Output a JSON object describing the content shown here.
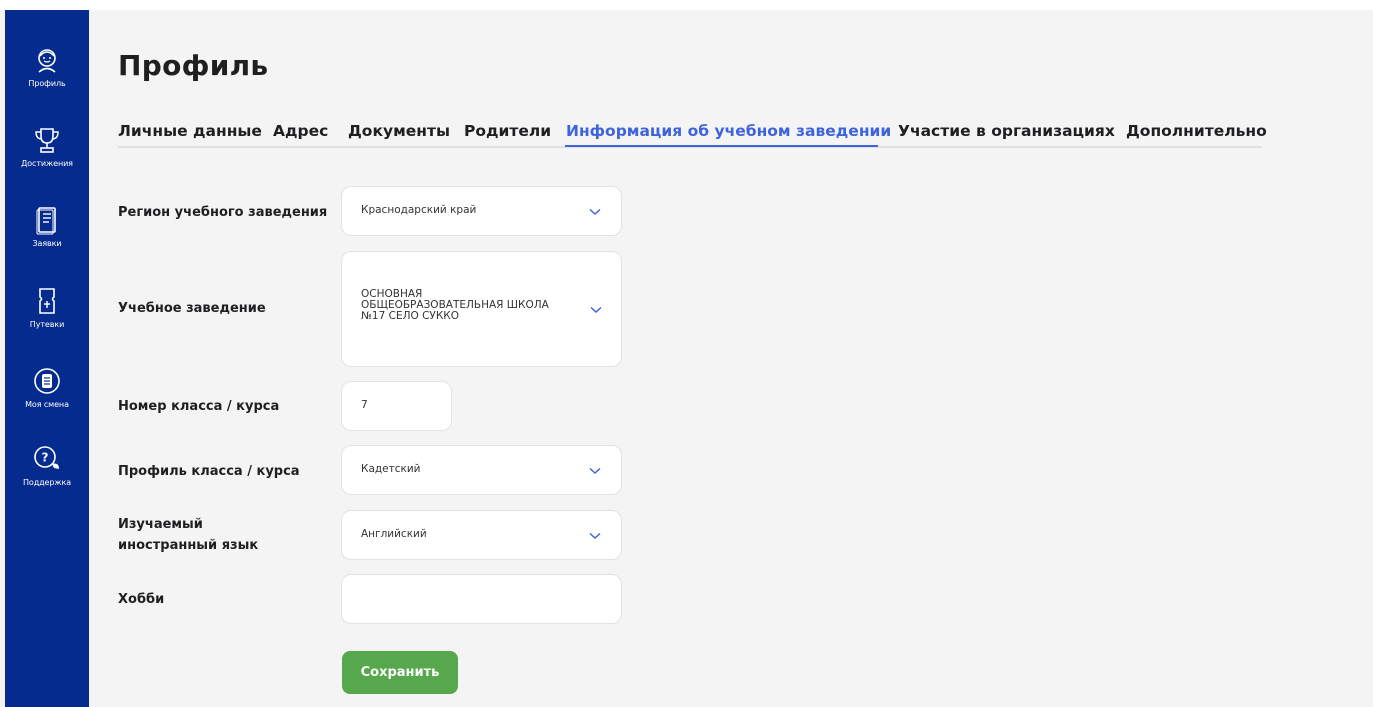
{
  "sidebar": {
    "items": [
      {
        "label": "Профиль",
        "icon": "profile-icon"
      },
      {
        "label": "Достижения",
        "icon": "trophy-icon"
      },
      {
        "label": "Заявки",
        "icon": "document-icon"
      },
      {
        "label": "Путевки",
        "icon": "ticket-icon"
      },
      {
        "label": "Моя смена",
        "icon": "shift-icon"
      },
      {
        "label": "Поддержка",
        "icon": "support-icon"
      }
    ]
  },
  "page": {
    "title": "Профиль"
  },
  "tabs": [
    {
      "label": "Личные данные",
      "active": false
    },
    {
      "label": "Адрес",
      "active": false
    },
    {
      "label": "Документы",
      "active": false
    },
    {
      "label": "Родители",
      "active": false
    },
    {
      "label": "Информация об учебном заведении",
      "active": true
    },
    {
      "label": "Участие в организациях",
      "active": false
    },
    {
      "label": "Дополнительно",
      "active": false
    }
  ],
  "form": {
    "region": {
      "label": "Регион учебного заведения",
      "value": "Краснодарский край"
    },
    "school": {
      "label": "Учебное заведение",
      "value_lines": [
        "ОСНОВНАЯ",
        "ОБЩЕОБРАЗОВАТЕЛЬНАЯ ШКОЛА",
        "№17 СЕЛО СУККО"
      ]
    },
    "grade": {
      "label": "Номер класса / курса",
      "value": "7"
    },
    "class_profile": {
      "label": "Профиль класса / курса",
      "value": "Кадетский"
    },
    "language": {
      "label_lines": [
        "Изучаемый",
        "иностранный язык"
      ],
      "value": "Английский"
    },
    "hobby": {
      "label": "Хобби",
      "value": ""
    },
    "save_label": "Сохранить"
  },
  "colors": {
    "sidebar_bg": "#062b8f",
    "accent": "#3f63dd",
    "save_button": "#57a84d",
    "page_bg": "#f4f4f5"
  }
}
